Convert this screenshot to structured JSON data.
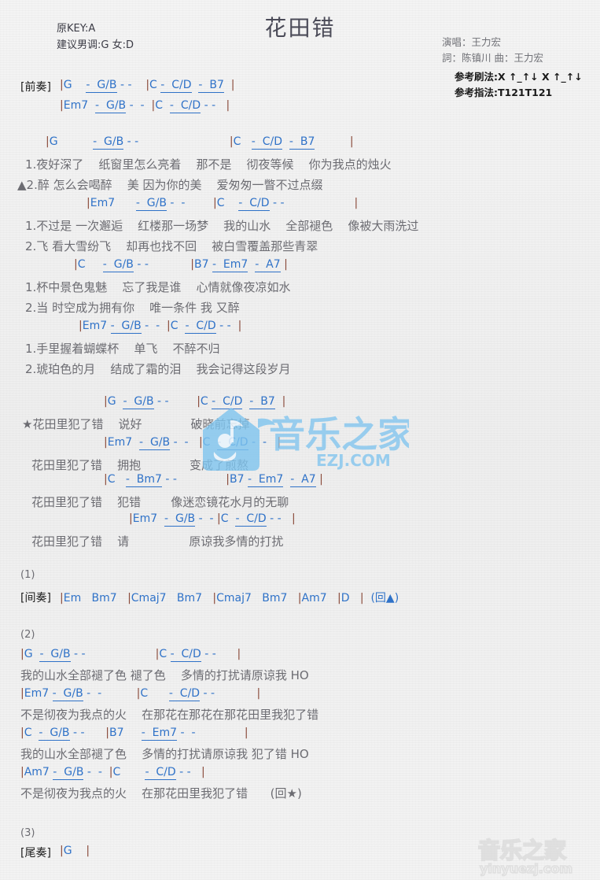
{
  "header": {
    "title": "花田错",
    "orig_key": "原KEY:A",
    "suggest_key": "建议男调:G 女:D",
    "singer": "演唱：王力宏",
    "credits": "詞：陈镇川  曲：王力宏",
    "strum_label": "参考刷法:",
    "strum_value": "X ↑_↑↓ X ↑_↑↓",
    "finger_label": "参考指法:",
    "finger_value": "T121T121"
  },
  "sections": {
    "intro_label": "[前奏]",
    "interlude_label": "[间奏]",
    "outro_label": "[尾奏]",
    "para1": "(1)",
    "para2": "(2)",
    "para3": "(3)"
  },
  "intro": {
    "line1": "|G    -  G/B - -    |C -  C/D  -  B7  |",
    "line2": "|Em7  -  G/B -  -  |C  -  C/D - -   |"
  },
  "verse": [
    {
      "chords": "|G          -  G/B - -                          |C   -  C/D  -  B7          |",
      "lyric1": "1.夜好深了    纸窗里怎么亮着    那不是    彻夜等候    你为我点的烛火",
      "lyric2": "▲2.醉 怎么会喝醉    美 因为你的美    爱匆匆一瞥不过点缀"
    },
    {
      "chords": "|Em7      -  G/B -  -        |C    -  C/D - -                    |",
      "lyric1": "1.不过是 一次邂逅    红楼那一场梦    我的山水    全部褪色    像被大雨洗过",
      "lyric2": "2.飞 看大雪纷飞    却再也找不回    被白雪覆盖那些青翠"
    },
    {
      "chords": "|C     -  G/B - -            |B7 -  Em7  -  A7 |",
      "lyric1": "1.杯中景色鬼魅    忘了我是谁    心情就像夜凉如水",
      "lyric2": "2.当 时空成为拥有你    唯一条件 我 又醉"
    },
    {
      "chords": "|Em7 -  G/B -  -  |C  -  C/D - -  |",
      "lyric1": "1.手里握着蝴蝶杯    单飞    不醉不归",
      "lyric2": "2.琥珀色的月    结成了霜的泪    我会记得这段岁月"
    }
  ],
  "chorus": [
    {
      "chords": "|G  -  G/B - -        |C -  C/D  -  B7  |",
      "lyric": "★花田里犯了错    说好             破晓前忘掉"
    },
    {
      "chords": "|Em7  -  G/B -  -   |C  -  C/D -  -   |",
      "lyric": "花田里犯了错    拥抱             变成了煎熬"
    },
    {
      "chords": "|C   -  Bm7 - -              |B7 -  Em7  -  A7 |",
      "lyric": "花田里犯了错    犯错        像迷恋镜花水月的无聊"
    },
    {
      "chords": "|Em7  -  G/B -  - |C  -  C/D - -   |",
      "lyric": "花田里犯了错    请                原谅我多情的打扰"
    }
  ],
  "interlude": {
    "chords": "|Em   Bm7   |Cmaj7   Bm7   |Cmaj7   Bm7   |Am7   |D   |  (回▲)"
  },
  "section2": [
    {
      "chords": "|G  -  G/B - -                    |C -  C/D - -      |",
      "lyric": "我的山水全部褪了色 褪了色    多情的打扰请原谅我 HO"
    },
    {
      "chords": "|Em7 -  G/B -  -          |C      -  C/D - -            |",
      "lyric": "不是彻夜为我点的火    在那花在那花在那花田里我犯了错"
    },
    {
      "chords": "|C  -  G/B - -      |B7     -  Em7 -  -              |",
      "lyric": "我的山水全部褪了色    多情的打扰请原谅我 犯了错 HO"
    },
    {
      "chords": "|Am7 -  G/B -  -  |C       -  C/D - -   |",
      "lyric": "不是彻夜为我点的火    在那花田里我犯了错      (回★)"
    }
  ],
  "outro": {
    "chords": "|G    |"
  },
  "watermark": {
    "center_text": "音乐之家",
    "center_domain": "EZJ.COM",
    "bottom_text": "音乐之家",
    "bottom_domain": "yinyuezj.com"
  },
  "colors": {
    "chord": "#2f72c8",
    "lyric": "#6c6c72",
    "bar": "#8a4a3a",
    "title": "#4b4b58",
    "watermark": "#7fc4ef"
  }
}
